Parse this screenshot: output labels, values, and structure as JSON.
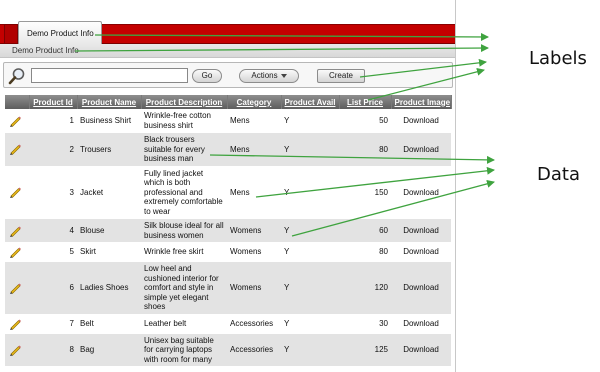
{
  "tab": {
    "label": "Demo Product Info"
  },
  "breadcrumb": {
    "label": "Demo Product Info"
  },
  "toolbar": {
    "search_placeholder": "",
    "go_label": "Go",
    "actions_label": "Actions",
    "create_label": "Create"
  },
  "table": {
    "headers": [
      "Product Id",
      "Product Name",
      "Product Description",
      "Category",
      "Product Avail",
      "List Price",
      "Product Image"
    ],
    "rows": [
      {
        "id": "1",
        "name": "Business Shirt",
        "desc": "Wrinkle-free cotton business shirt",
        "category": "Mens",
        "avail": "Y",
        "price": "50",
        "image": "Download"
      },
      {
        "id": "2",
        "name": "Trousers",
        "desc": "Black trousers suitable for every business man",
        "category": "Mens",
        "avail": "Y",
        "price": "80",
        "image": "Download"
      },
      {
        "id": "3",
        "name": "Jacket",
        "desc": "Fully lined jacket which is both professional and extremely comfortable to wear",
        "category": "Mens",
        "avail": "Y",
        "price": "150",
        "image": "Download"
      },
      {
        "id": "4",
        "name": "Blouse",
        "desc": "Silk blouse ideal for all business women",
        "category": "Womens",
        "avail": "Y",
        "price": "60",
        "image": "Download"
      },
      {
        "id": "5",
        "name": "Skirt",
        "desc": "Wrinkle free skirt",
        "category": "Womens",
        "avail": "Y",
        "price": "80",
        "image": "Download"
      },
      {
        "id": "6",
        "name": "Ladies Shoes",
        "desc": "Low heel and cushioned interior for comfort and style in simple yet elegant shoes",
        "category": "Womens",
        "avail": "Y",
        "price": "120",
        "image": "Download"
      },
      {
        "id": "7",
        "name": "Belt",
        "desc": "Leather belt",
        "category": "Accessories",
        "avail": "Y",
        "price": "30",
        "image": "Download"
      },
      {
        "id": "8",
        "name": "Bag",
        "desc": "Unisex bag suitable for carrying laptops with room for many",
        "category": "Accessories",
        "avail": "Y",
        "price": "125",
        "image": "Download"
      }
    ]
  },
  "annotations": {
    "labels": "Labels",
    "data": "Data",
    "arrow_color": "#3fa33f"
  },
  "colors": {
    "topbar": "#c40000",
    "table_header": "#6f6f6f",
    "row_alt": "#e3e3e3"
  }
}
